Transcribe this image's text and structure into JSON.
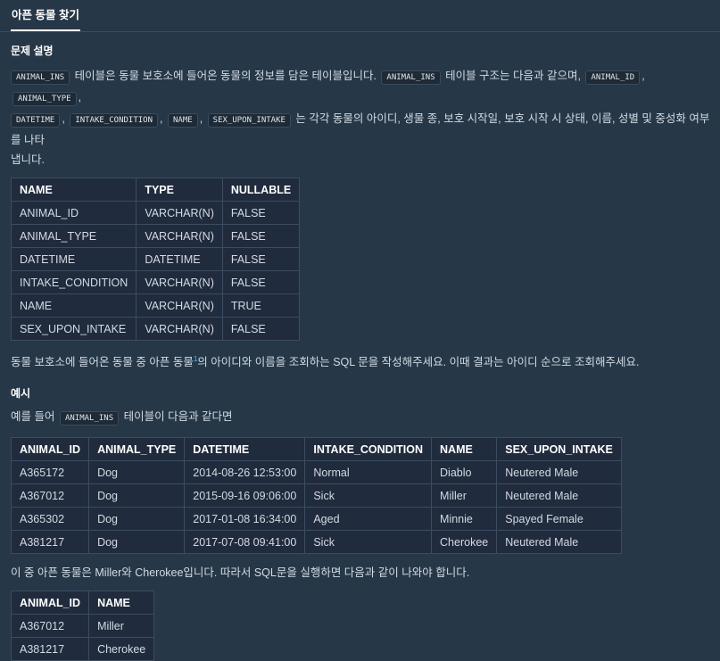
{
  "tab": {
    "label": "아픈 동물 찾기"
  },
  "section_title": "문제 설명",
  "intro": {
    "code1": "ANIMAL_INS",
    "t1": " 테이블은 동물 보호소에 들어온 동물의 정보를 담은 테이블입니다. ",
    "code2": "ANIMAL_INS",
    "t2": " 테이블 구조는 다음과 같으며, ",
    "cols": [
      "ANIMAL_ID",
      "ANIMAL_TYPE",
      "DATETIME",
      "INTAKE_CONDITION",
      "NAME",
      "SEX_UPON_INTAKE"
    ],
    "sep": ",",
    "t3": " 는 각각 동물의 아이디, 생물 종, 보호 시작일, 보호 시작 시 상태, 이름, 성별 및 중성화 여부를 나타",
    "t4": "냅니다."
  },
  "schema_table": {
    "headers": [
      "NAME",
      "TYPE",
      "NULLABLE"
    ],
    "rows": [
      [
        "ANIMAL_ID",
        "VARCHAR(N)",
        "FALSE"
      ],
      [
        "ANIMAL_TYPE",
        "VARCHAR(N)",
        "FALSE"
      ],
      [
        "DATETIME",
        "DATETIME",
        "FALSE"
      ],
      [
        "INTAKE_CONDITION",
        "VARCHAR(N)",
        "FALSE"
      ],
      [
        "NAME",
        "VARCHAR(N)",
        "TRUE"
      ],
      [
        "SEX_UPON_INTAKE",
        "VARCHAR(N)",
        "FALSE"
      ]
    ]
  },
  "question": {
    "before": "동물 보호소에 들어온 동물 중 아픈 동물",
    "footnote": "1",
    "after": "의 아이디와 이름을 조회하는 SQL 문을 작성해주세요. 이때 결과는 아이디 순으로 조회해주세요."
  },
  "example": {
    "title": "예시",
    "intro_before": "예를 들어 ",
    "code": "ANIMAL_INS",
    "intro_after": " 테이블이 다음과 같다면",
    "table": {
      "headers": [
        "ANIMAL_ID",
        "ANIMAL_TYPE",
        "DATETIME",
        "INTAKE_CONDITION",
        "NAME",
        "SEX_UPON_INTAKE"
      ],
      "rows": [
        [
          "A365172",
          "Dog",
          "2014-08-26 12:53:00",
          "Normal",
          "Diablo",
          "Neutered Male"
        ],
        [
          "A367012",
          "Dog",
          "2015-09-16 09:06:00",
          "Sick",
          "Miller",
          "Neutered Male"
        ],
        [
          "A365302",
          "Dog",
          "2017-01-08 16:34:00",
          "Aged",
          "Minnie",
          "Spayed Female"
        ],
        [
          "A381217",
          "Dog",
          "2017-07-08 09:41:00",
          "Sick",
          "Cherokee",
          "Neutered Male"
        ]
      ]
    },
    "result_text": "이 중 아픈 동물은 Miller와 Cherokee입니다. 따라서 SQL문을 실행하면 다음과 같이 나와야 합니다.",
    "result_table": {
      "headers": [
        "ANIMAL_ID",
        "NAME"
      ],
      "rows": [
        [
          "A367012",
          "Miller"
        ],
        [
          "A381217",
          "Cherokee"
        ]
      ]
    }
  },
  "colors": {
    "background": "#263747",
    "table_bg": "#202b3d",
    "border": "#3b4d5f",
    "link": "#44c4ff"
  }
}
